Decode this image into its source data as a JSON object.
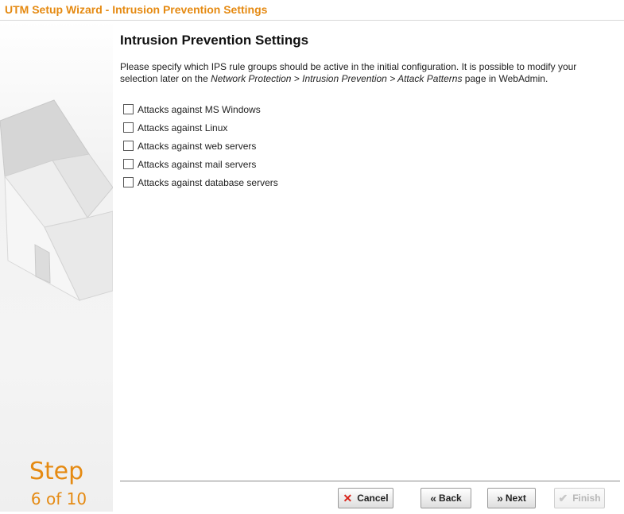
{
  "window": {
    "title": "UTM Setup Wizard - Intrusion Prevention Settings"
  },
  "sidebar": {
    "step_word": "Step",
    "step_count": "6 of 10"
  },
  "main": {
    "heading": "Intrusion Prevention Settings",
    "description": {
      "part1": "Please specify which IPS rule groups should be active in the initial configuration. It is possible to modify your selection later on the ",
      "path": "Network Protection > Intrusion Prevention > Attack Patterns",
      "part2": " page in WebAdmin."
    },
    "options": [
      {
        "label": "Attacks against MS Windows",
        "checked": false
      },
      {
        "label": "Attacks against Linux",
        "checked": false
      },
      {
        "label": "Attacks against web servers",
        "checked": false
      },
      {
        "label": "Attacks against mail servers",
        "checked": false
      },
      {
        "label": "Attacks against database servers",
        "checked": false
      }
    ]
  },
  "buttons": {
    "cancel": "Cancel",
    "back": "Back",
    "next": "Next",
    "finish": "Finish"
  },
  "colors": {
    "accent": "#e58a12",
    "cancel_icon": "#d8231a"
  }
}
